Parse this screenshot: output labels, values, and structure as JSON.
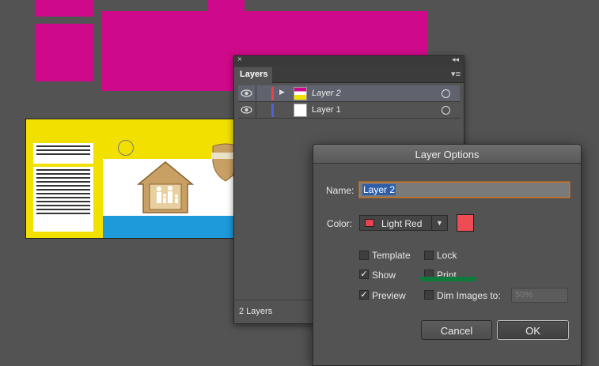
{
  "layers_panel": {
    "tab_label": "Layers",
    "close_glyph": "×",
    "collapse_glyph": "◂◂",
    "menu_glyph": "▾≡",
    "layers": [
      {
        "name": "Layer 2",
        "selected": true,
        "color": "#e8424c",
        "visible": true,
        "expandable": true
      },
      {
        "name": "Layer 1",
        "selected": false,
        "color": "#4d63d4",
        "visible": true,
        "expandable": false
      }
    ],
    "status": "2 Layers"
  },
  "dialog": {
    "title": "Layer Options",
    "name_label": "Name:",
    "name_value": "Layer 2",
    "color_label": "Color:",
    "color_value": "Light Red",
    "color_hex": "#ee4c55",
    "options": {
      "template": {
        "label": "Template",
        "checked": false
      },
      "lock": {
        "label": "Lock",
        "checked": false
      },
      "show": {
        "label": "Show",
        "checked": true
      },
      "print": {
        "label": "Print",
        "checked": false
      },
      "preview": {
        "label": "Preview",
        "checked": true
      },
      "dim_images": {
        "label": "Dim Images to:",
        "checked": false,
        "value": "50%"
      }
    },
    "cancel_label": "Cancel",
    "ok_label": "OK"
  },
  "colors": {
    "canvas_bg": "#535353",
    "magenta_shape": "#cf0a8a",
    "artboard_yellow": "#f2e000",
    "artboard_blue": "#1d9ad9"
  }
}
